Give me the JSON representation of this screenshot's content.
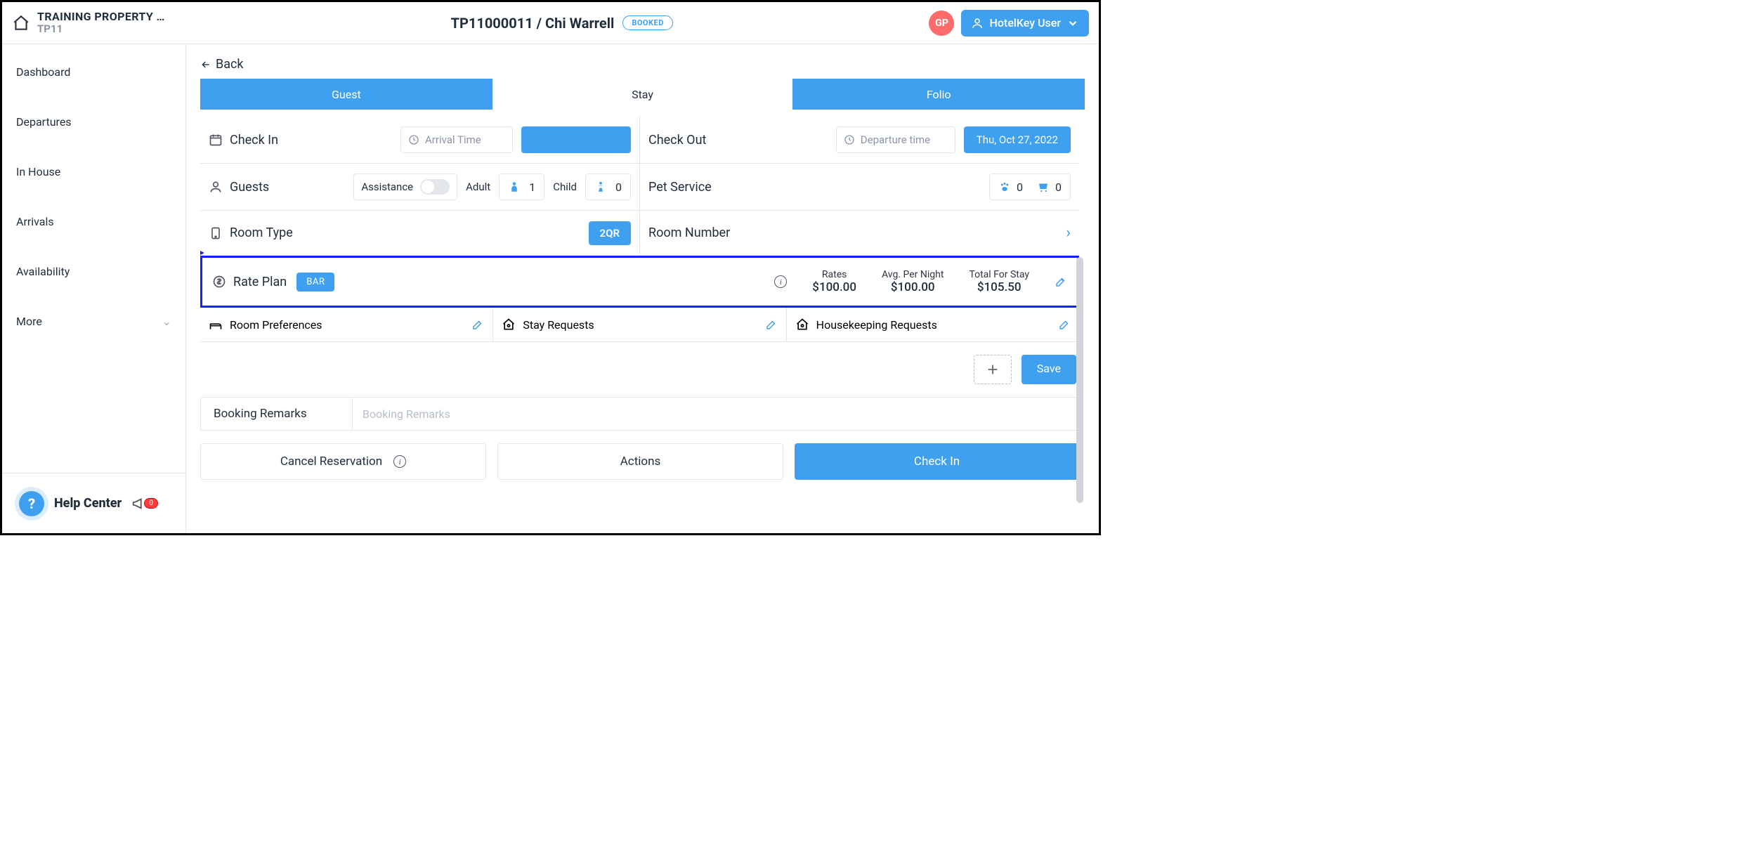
{
  "header": {
    "property_name": "TRAINING PROPERTY …",
    "property_code": "TP11",
    "reservation_title": "TP11000011 / Chi Warrell",
    "status_badge": "BOOKED",
    "avatar_initials": "GP",
    "user_button": "HotelKey User"
  },
  "sidebar": {
    "items": [
      {
        "label": "Dashboard"
      },
      {
        "label": "Departures"
      },
      {
        "label": "In House"
      },
      {
        "label": "Arrivals"
      },
      {
        "label": "Availability"
      },
      {
        "label": "More",
        "hasChevron": true
      }
    ],
    "help_label": "Help Center",
    "notif_count": "0"
  },
  "tabs": {
    "guest": "Guest",
    "stay": "Stay",
    "folio": "Folio",
    "active": "Guest"
  },
  "back_label": "Back",
  "stay": {
    "checkin_label": "Check In",
    "arrival_placeholder": "Arrival Time",
    "checkin_date": "",
    "checkout_label": "Check Out",
    "departure_placeholder": "Departure time",
    "checkout_date": "Thu, Oct 27, 2022",
    "guests_label": "Guests",
    "assistance_label": "Assistance",
    "adult_label": "Adult",
    "adult_count": "1",
    "child_label": "Child",
    "child_count": "0",
    "pet_label": "Pet Service",
    "pets_a": "0",
    "pets_b": "0",
    "roomtype_label": "Room Type",
    "roomtype_value": "2QR",
    "roomnumber_label": "Room Number",
    "rateplan_label": "Rate Plan",
    "rateplan_value": "BAR",
    "rates_label": "Rates",
    "rates_value": "$100.00",
    "avg_label": "Avg. Per Night",
    "avg_value": "$100.00",
    "total_label": "Total For Stay",
    "total_value": "$105.50",
    "room_pref": "Room Preferences",
    "stay_req": "Stay Requests",
    "hk_req": "Housekeeping Requests",
    "save": "Save",
    "remarks_label": "Booking Remarks",
    "remarks_placeholder": "Booking Remarks"
  },
  "footer": {
    "cancel": "Cancel Reservation",
    "actions": "Actions",
    "checkin": "Check In"
  }
}
